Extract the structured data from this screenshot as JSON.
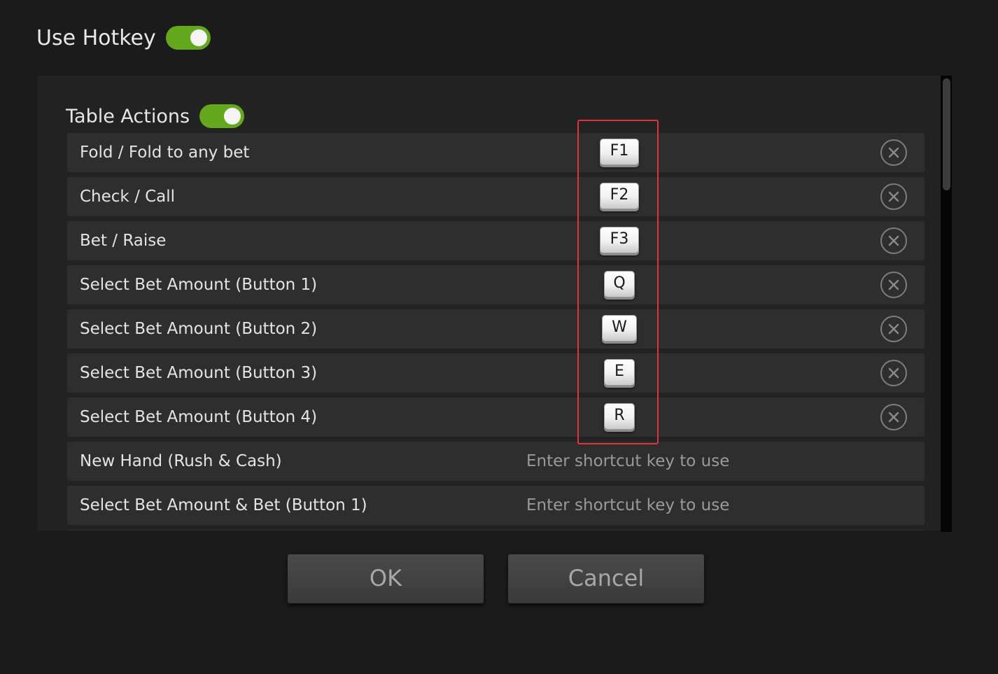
{
  "header": {
    "title": "Use Hotkey",
    "toggle_on": true
  },
  "section": {
    "title": "Table Actions",
    "toggle_on": true
  },
  "rows": [
    {
      "label": "Fold / Fold to any bet",
      "key": "F1"
    },
    {
      "label": "Check / Call",
      "key": "F2"
    },
    {
      "label": "Bet / Raise",
      "key": "F3"
    },
    {
      "label": "Select Bet Amount (Button 1)",
      "key": "Q"
    },
    {
      "label": "Select Bet Amount (Button 2)",
      "key": "W"
    },
    {
      "label": "Select Bet Amount (Button 3)",
      "key": "E"
    },
    {
      "label": "Select Bet Amount (Button 4)",
      "key": "R"
    },
    {
      "label": "New Hand (Rush & Cash)",
      "placeholder": "Enter shortcut key to use"
    },
    {
      "label": "Select Bet Amount & Bet (Button 1)",
      "placeholder": "Enter shortcut key to use"
    }
  ],
  "buttons": {
    "ok_label": "OK",
    "cancel_label": "Cancel"
  },
  "colors": {
    "toggle_on": "#64a81e",
    "highlight_box": "#e0333a",
    "background": "#1b1b1b",
    "row_background": "#2e2e2e"
  },
  "icons": {
    "clear": "close-circle-icon"
  }
}
